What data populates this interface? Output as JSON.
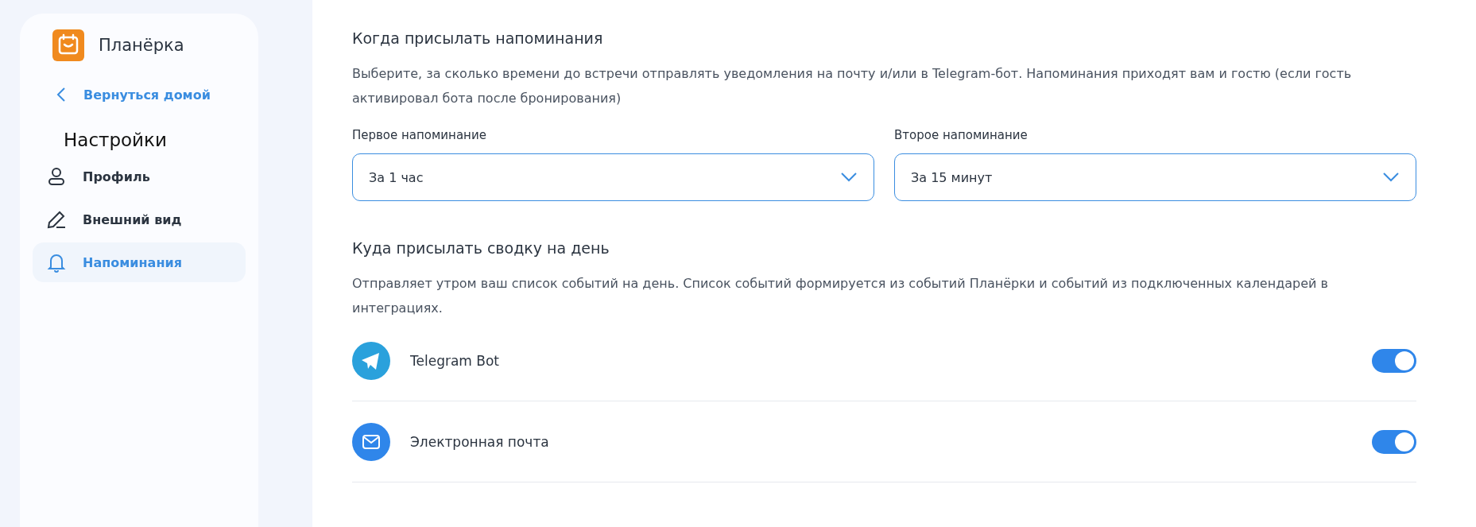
{
  "sidebar": {
    "app_name": "Планёрка",
    "back_link": "Вернуться домой",
    "heading": "Настройки",
    "items": [
      {
        "label": "Профиль",
        "kind": "person",
        "selected": false
      },
      {
        "label": "Внешний вид",
        "kind": "pen",
        "selected": false
      },
      {
        "label": "Напоминания",
        "kind": "bell",
        "selected": true
      }
    ]
  },
  "reminders": {
    "title": "Когда присылать напоминания",
    "description": "Выберите, за сколько времени до встречи отправлять уведомления на почту и/или в Telegram-бот. Напоминания приходят вам и гостю (если гость активировал бота после бронирования)",
    "selects": [
      {
        "label": "Первое напоминание",
        "value": "За 1 час"
      },
      {
        "label": "Второе напоминание",
        "value": "За 15 минут"
      }
    ]
  },
  "daily_summary": {
    "title": "Куда присылать сводку на день",
    "description": "Отправляет утром ваш список событий на день. Список событий формируется из событий Планёрки и событий из подключенных календарей в интеграциях.",
    "channels": [
      {
        "label": "Telegram Bot",
        "kind": "telegram",
        "on": true
      },
      {
        "label": "Электронная почта",
        "kind": "email",
        "on": true
      }
    ]
  }
}
